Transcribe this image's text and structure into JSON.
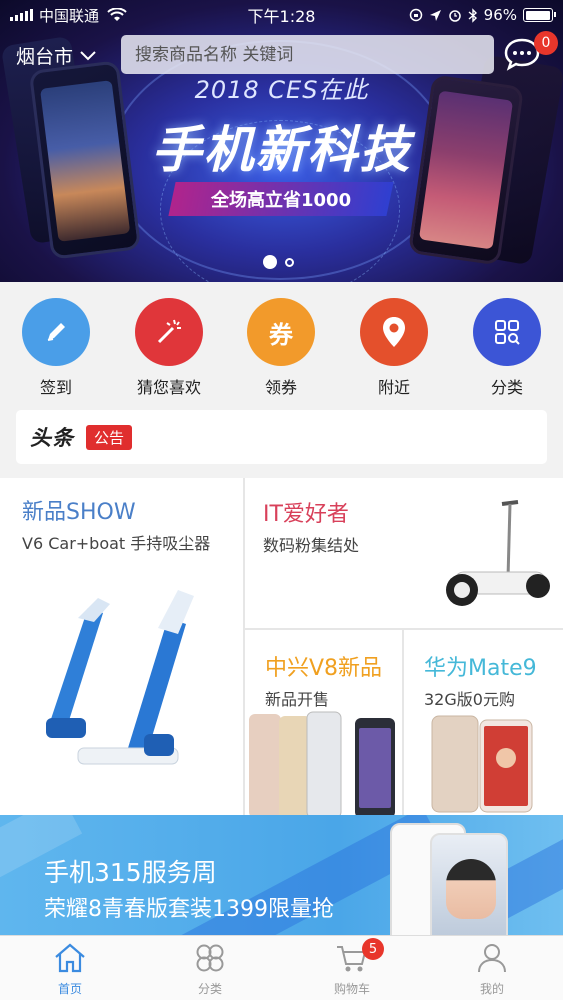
{
  "status_bar": {
    "carrier": "中国联通",
    "time": "下午1:28",
    "battery": "96%"
  },
  "header": {
    "city": "烟台市",
    "search_placeholder": "搜索商品名称 关键词",
    "message_count": "0"
  },
  "banner": {
    "line1": "2018 CES在此",
    "title": "手机新科技",
    "subtitle": "全场高立省1000"
  },
  "quick_entries": [
    {
      "label": "签到",
      "icon": "pencil-icon",
      "color": "#4a9ee8"
    },
    {
      "label": "猜您喜欢",
      "icon": "magic-wand-icon",
      "color": "#e0363a"
    },
    {
      "label": "领券",
      "icon": "coupon-icon",
      "icon_text": "券",
      "color": "#f29a2b"
    },
    {
      "label": "附近",
      "icon": "location-pin-icon",
      "color": "#e4502c"
    },
    {
      "label": "分类",
      "icon": "category-grid-icon",
      "color": "#3c55d6"
    }
  ],
  "headline": {
    "brand": "头条",
    "tag": "公告"
  },
  "grid": {
    "show": {
      "title": "新品SHOW",
      "subtitle": "V6 Car+boat 手持吸尘器",
      "title_color": "#4a7fc8"
    },
    "it": {
      "title": "IT爱好者",
      "subtitle": "数码粉集结处",
      "title_color": "#d8405a"
    },
    "zte": {
      "title": "中兴V8新品",
      "subtitle": "新品开售",
      "title_color": "#f0a020"
    },
    "huawei": {
      "title": "华为Mate9",
      "subtitle": "32G版0元购",
      "title_color": "#45b8d8"
    }
  },
  "promo": {
    "title": "手机315服务周",
    "subtitle": "荣耀8青春版套装1399限量抢"
  },
  "tabbar": {
    "items": [
      {
        "label": "首页",
        "icon": "home-icon",
        "active": true
      },
      {
        "label": "分类",
        "icon": "category-icon",
        "active": false
      },
      {
        "label": "购物车",
        "icon": "cart-icon",
        "active": false,
        "badge": "5"
      },
      {
        "label": "我的",
        "icon": "user-icon",
        "active": false
      }
    ],
    "active_color": "#3b8be0",
    "inactive_color": "#999999"
  }
}
